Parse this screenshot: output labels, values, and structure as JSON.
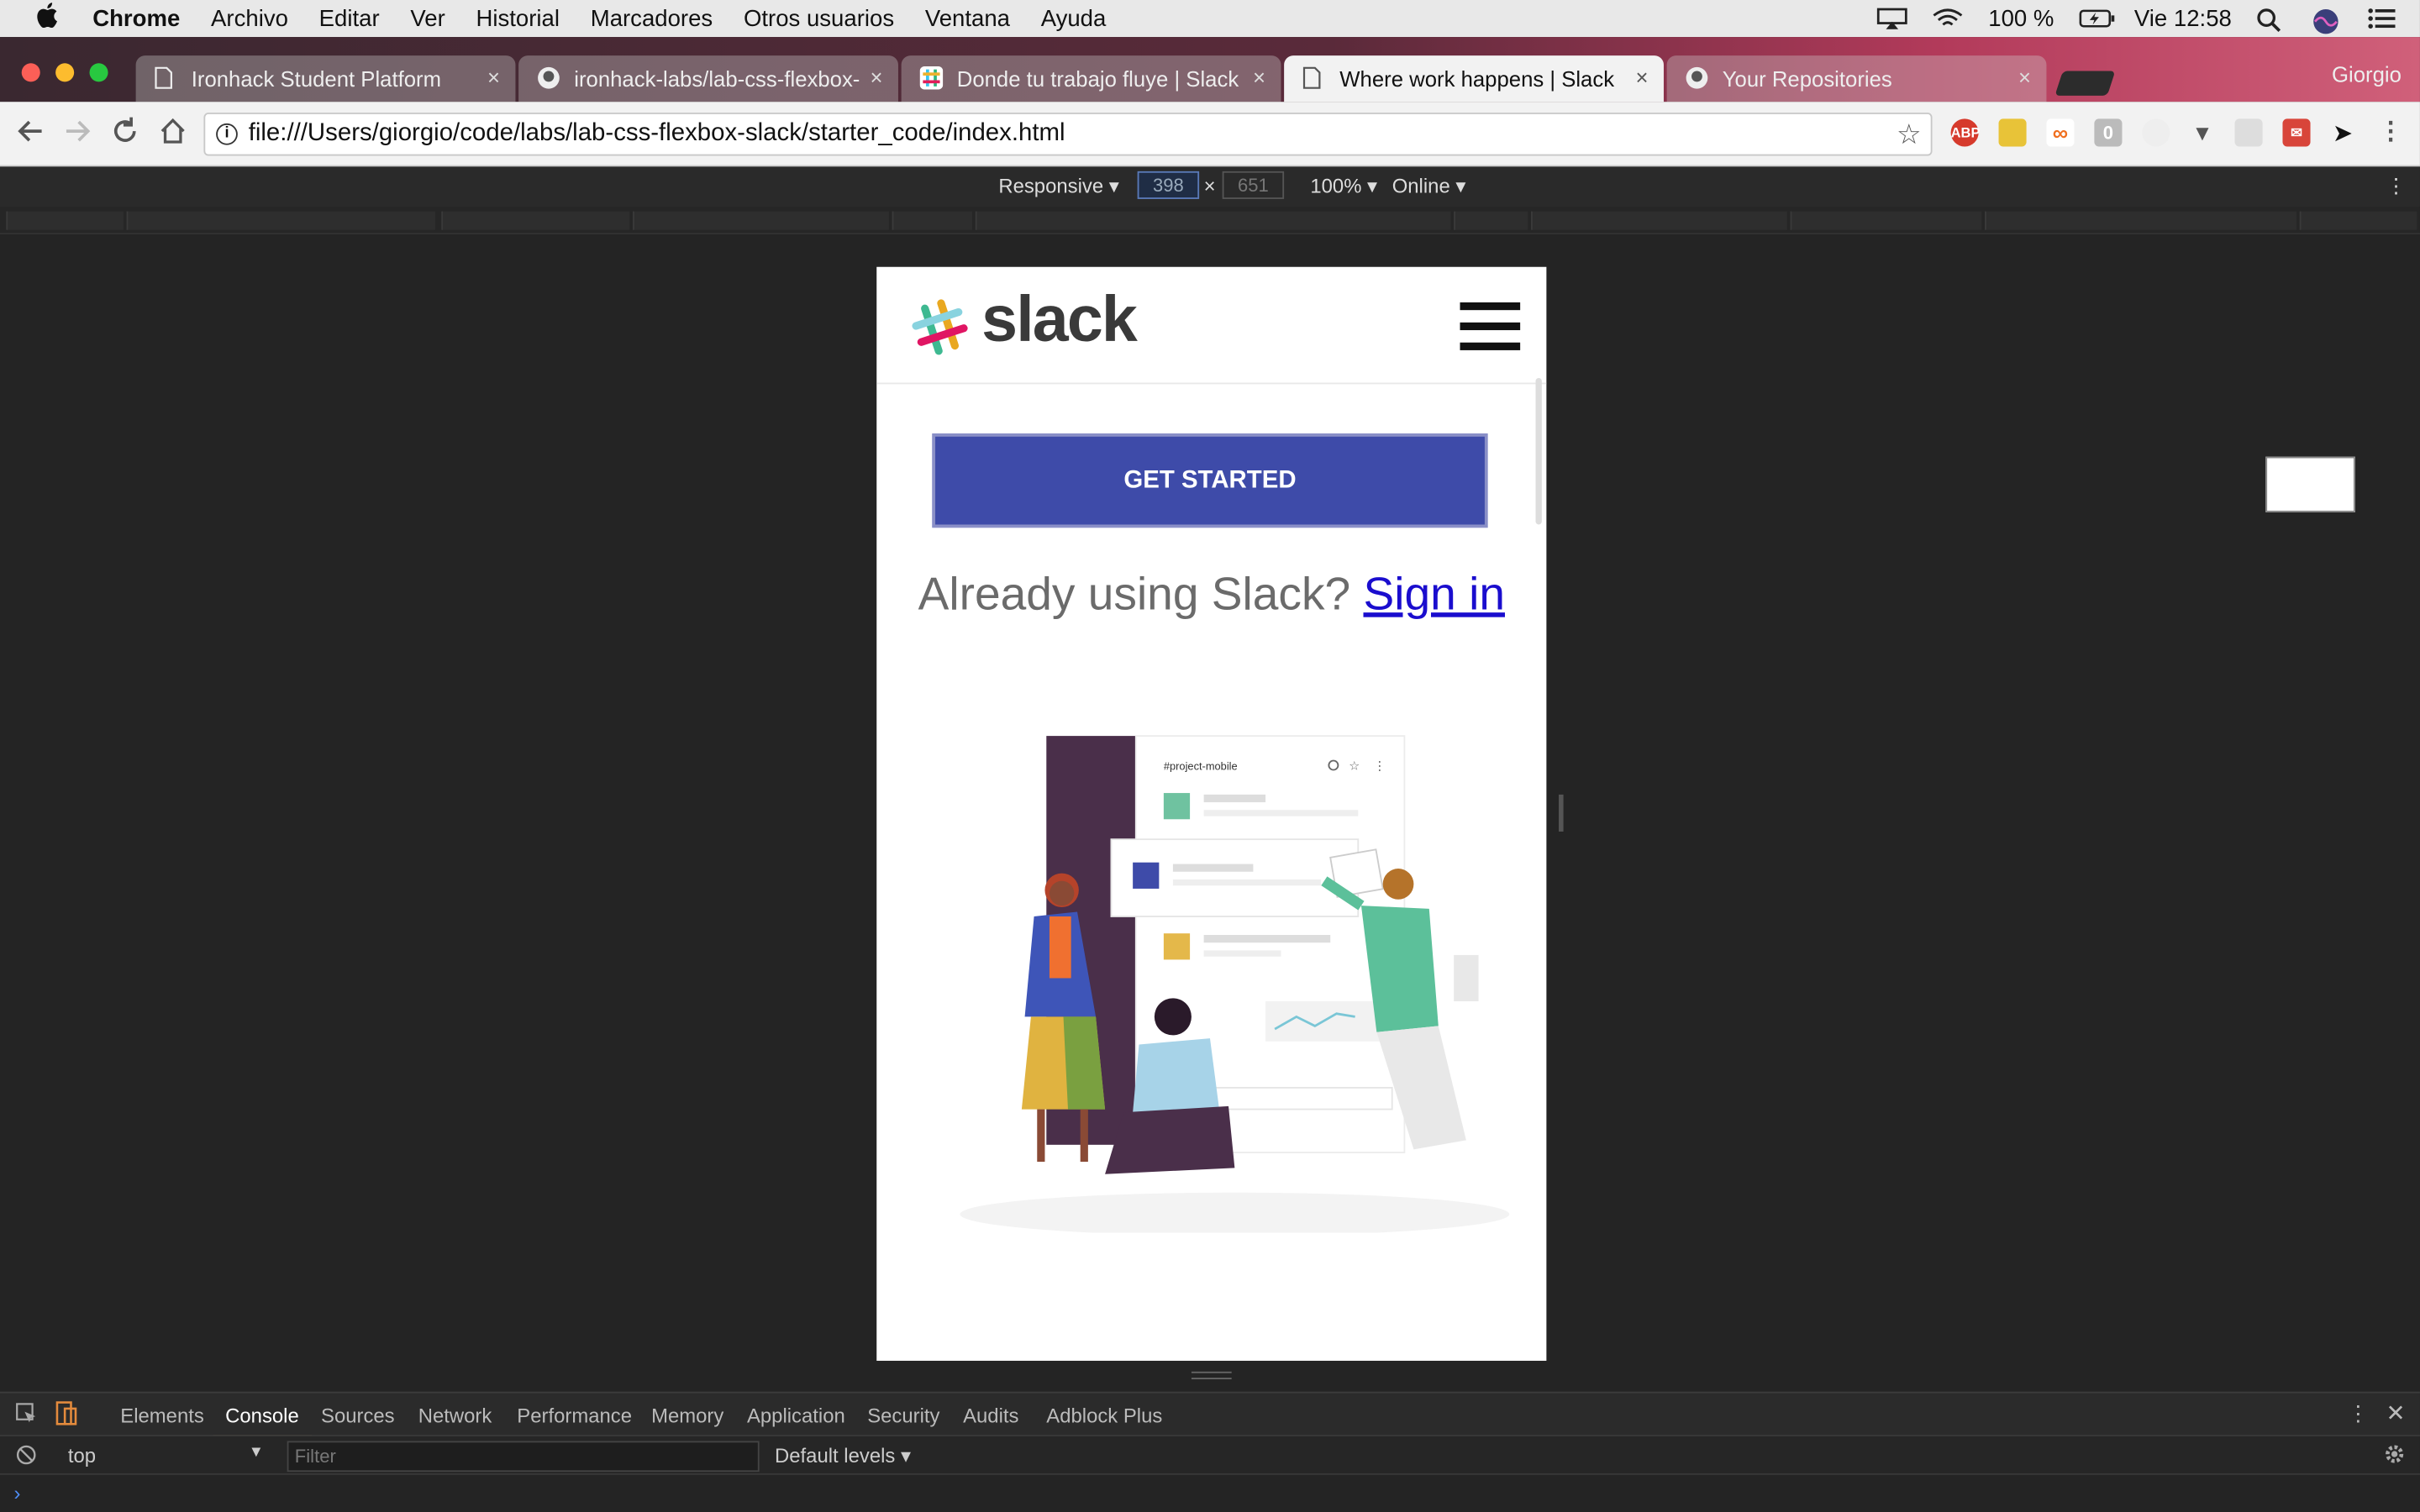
{
  "menubar": {
    "app": "Chrome",
    "items": [
      "Archivo",
      "Editar",
      "Ver",
      "Historial",
      "Marcadores",
      "Otros usuarios",
      "Ventana",
      "Ayuda"
    ],
    "battery": "100 %",
    "clock": "Vie 12:58"
  },
  "tabs": [
    {
      "title": "Ironhack Student Platform",
      "icon": "document-icon"
    },
    {
      "title": "ironhack-labs/lab-css-flexbox-",
      "icon": "github-icon"
    },
    {
      "title": "Donde tu trabajo fluye | Slack",
      "icon": "slack-icon"
    },
    {
      "title": "Where work happens | Slack",
      "icon": "document-icon"
    },
    {
      "title": "Your Repositories",
      "icon": "github-icon"
    }
  ],
  "tab_close_glyph": "×",
  "profile_name": "Giorgio",
  "url": "file:///Users/giorgio/code/labs/lab-css-flexbox-slack/starter_code/index.html",
  "devbar": {
    "device": "Responsive",
    "width": "398",
    "height": "651",
    "times": "×",
    "zoom": "100%",
    "network": "Online"
  },
  "page": {
    "logo_text": "slack",
    "cta_label": "GET STARTED",
    "signin_prompt": "Already using Slack?",
    "signin_link": "Sign in",
    "channel_name": "#project-mobile"
  },
  "devtools": {
    "tabs": [
      "Elements",
      "Console",
      "Sources",
      "Network",
      "Performance",
      "Memory",
      "Application",
      "Security",
      "Audits",
      "Adblock Plus"
    ],
    "active_tab": "Console",
    "context": "top",
    "filter_placeholder": "Filter",
    "levels": "Default levels"
  },
  "colors": {
    "cta": "#3e4ba9",
    "link": "#1a0dce",
    "active_tab_indicator": "#e48b3d"
  }
}
